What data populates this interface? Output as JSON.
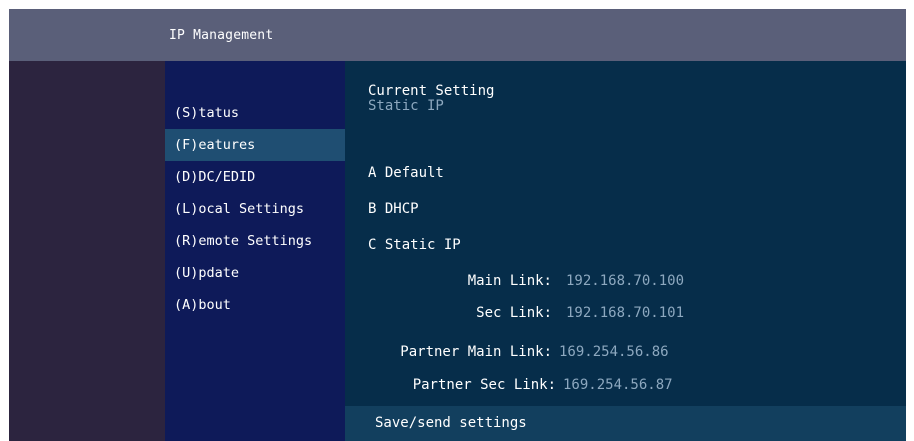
{
  "window": {
    "title": "IP Management"
  },
  "sidebar": {
    "items": [
      {
        "label": "(S)tatus"
      },
      {
        "label": "(F)eatures",
        "selected": true
      },
      {
        "label": "(D)DC/EDID"
      },
      {
        "label": "(L)ocal  Settings"
      },
      {
        "label": "(R)emote Settings"
      },
      {
        "label": "(U)pdate"
      },
      {
        "label": "(A)bout"
      }
    ]
  },
  "main": {
    "current_setting_label": "Current Setting",
    "current_setting_value": "Static IP",
    "options": [
      {
        "label": "A Default"
      },
      {
        "label": "B DHCP"
      },
      {
        "label": "C Static IP"
      }
    ],
    "ip_fields": [
      {
        "label": "Main Link:",
        "value": "192.168.70.100"
      },
      {
        "label": "Sec Link:",
        "value": "192.168.70.101"
      },
      {
        "label": "Partner Main Link:",
        "value": "169.254.56.86"
      },
      {
        "label": "Partner Sec Link:",
        "value": "169.254.56.87"
      }
    ],
    "save_label": "Save/send settings"
  },
  "colors": {
    "titlebar": "#5a5f79",
    "sidebar": "#0e1a59",
    "sidebar_selected": "#1f4e72",
    "main": "#062d4a",
    "save_bar": "#123f5e",
    "value_text": "#8da8bf"
  }
}
